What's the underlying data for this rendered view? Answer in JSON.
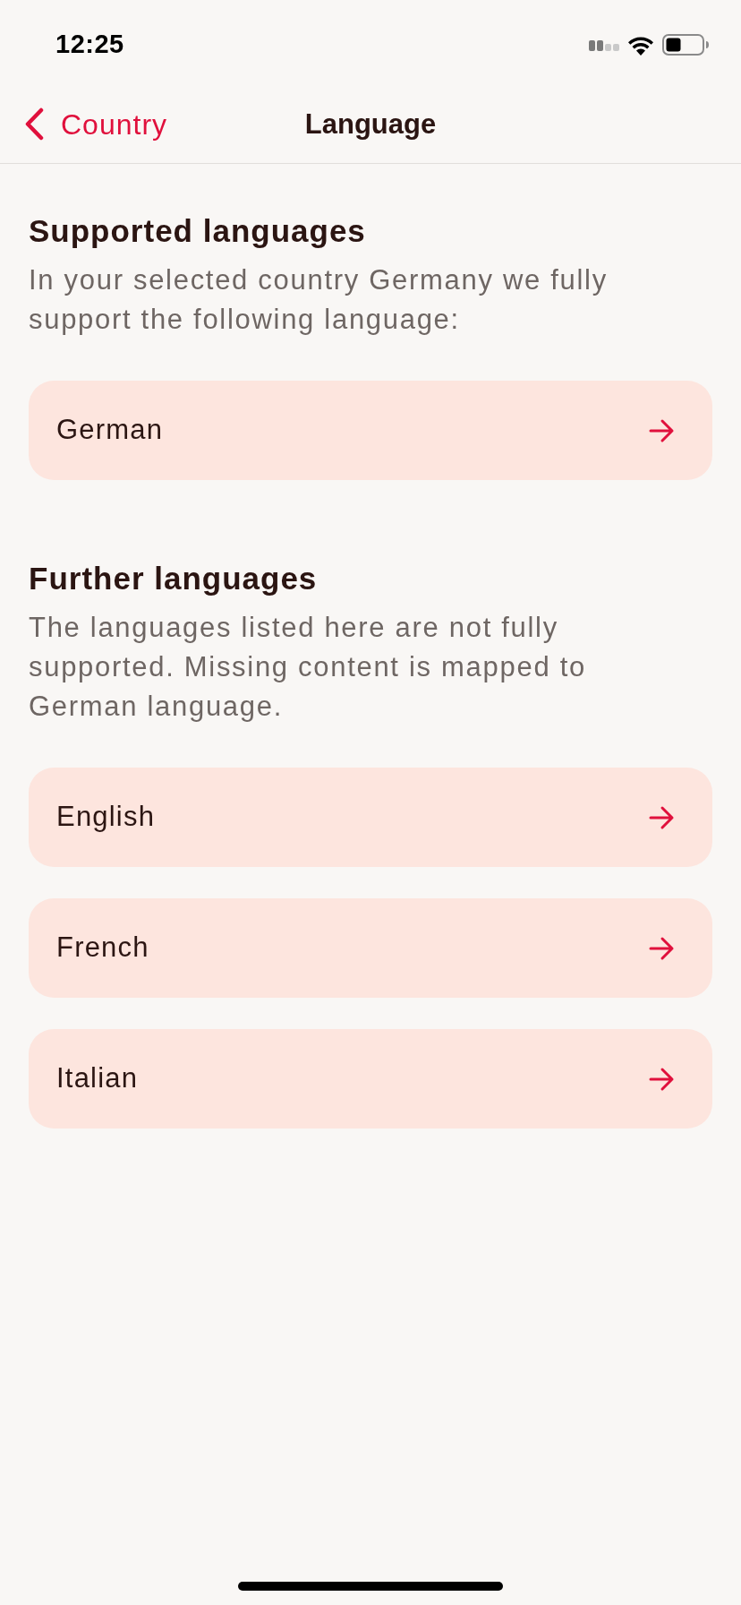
{
  "status_bar": {
    "time": "12:25"
  },
  "nav": {
    "back_label": "Country",
    "title": "Language"
  },
  "sections": [
    {
      "heading": "Supported languages",
      "description": "In your selected country Germany we fully support the following language:",
      "languages": [
        {
          "label": "German"
        }
      ]
    },
    {
      "heading": "Further languages",
      "description": "The languages listed here are not fully supported. Missing content is mapped to German language.",
      "languages": [
        {
          "label": "English"
        },
        {
          "label": "French"
        },
        {
          "label": "Italian"
        }
      ]
    }
  ]
}
